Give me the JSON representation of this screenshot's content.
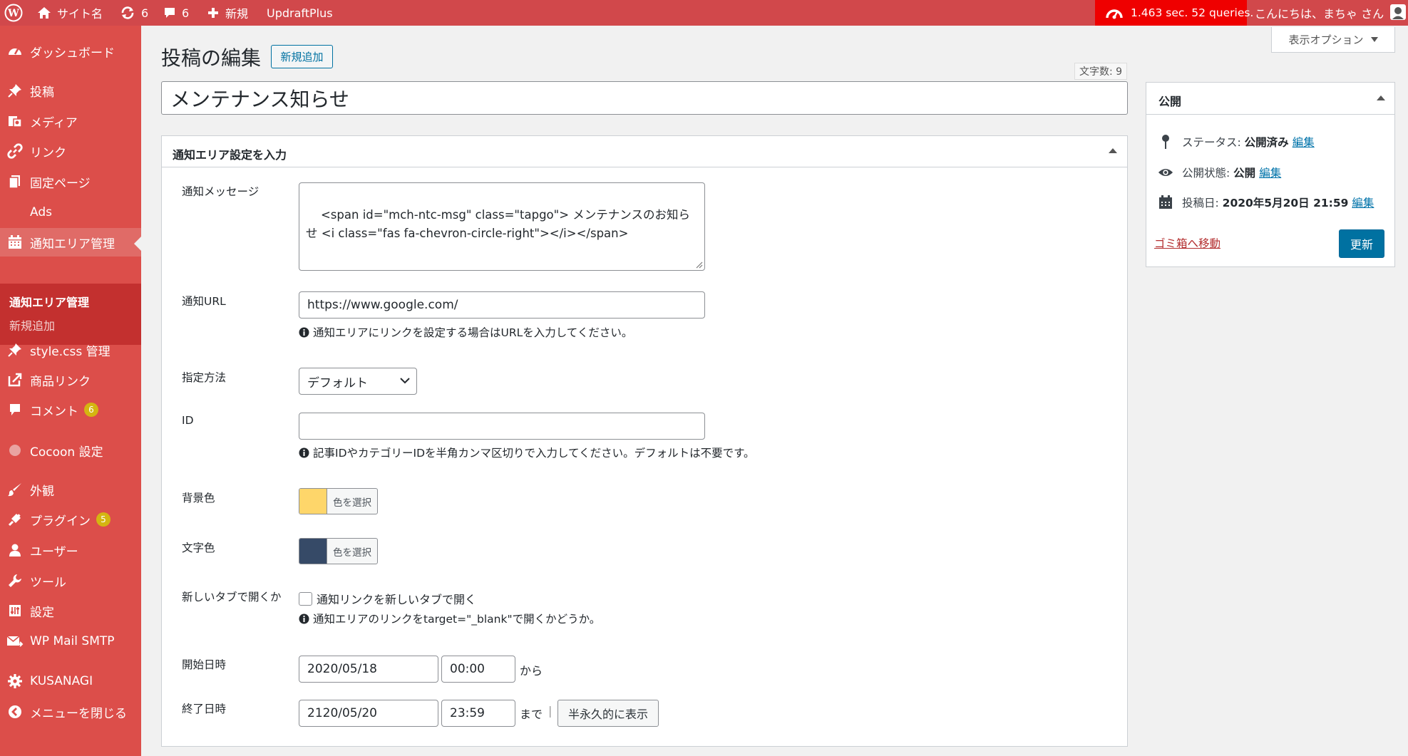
{
  "adminbar": {
    "site_name": "サイト名",
    "updates_count": "6",
    "comments_count": "6",
    "new_label": "新規",
    "plugin_label": "UpdraftPlus",
    "perf_text": "1.463 sec. 52 queries.",
    "greeting": "こんにちは、まちゃ さん"
  },
  "sidebar": {
    "items": [
      {
        "label": "ダッシュボード",
        "icon": "dashboard-icon"
      },
      {
        "label": "投稿",
        "icon": "pin-icon"
      },
      {
        "label": "メディア",
        "icon": "media-icon"
      },
      {
        "label": "リンク",
        "icon": "link-icon"
      },
      {
        "label": "固定ページ",
        "icon": "page-icon"
      },
      {
        "label": "Ads",
        "icon": ""
      },
      {
        "label": "通知エリア管理",
        "icon": "calendar-icon"
      },
      {
        "label": "style.css 管理",
        "icon": "pin-icon"
      },
      {
        "label": "商品リンク",
        "icon": "external-link-icon"
      },
      {
        "label": "コメント",
        "icon": "comment-icon",
        "badge": "6"
      },
      {
        "label": "Cocoon 設定",
        "icon": "circle-icon"
      },
      {
        "label": "外観",
        "icon": "brush-icon"
      },
      {
        "label": "プラグイン",
        "icon": "plugin-icon",
        "badge": "5"
      },
      {
        "label": "ユーザー",
        "icon": "user-icon"
      },
      {
        "label": "ツール",
        "icon": "wrench-icon"
      },
      {
        "label": "設定",
        "icon": "settings-icon"
      },
      {
        "label": "WP Mail SMTP",
        "icon": "mail-icon"
      },
      {
        "label": "KUSANAGI",
        "icon": "gear-icon"
      },
      {
        "label": "メニューを閉じる",
        "icon": "collapse-icon"
      }
    ],
    "submenu": [
      "通知エリア管理",
      "新規追加"
    ]
  },
  "header": {
    "title": "投稿の編集",
    "add_new": "新規追加",
    "screen_options": "表示オプション",
    "word_count": "文字数: 9"
  },
  "post": {
    "title": "メンテナンス知らせ"
  },
  "metabox": {
    "title": "通知エリア設定を入力",
    "message_label": "通知メッセージ",
    "message_value": "<span id=\"mch-ntc-msg\" class=\"tapgo\"> メンテナンスのお知らせ <i class=\"fas fa-chevron-circle-right\"></i></span>",
    "url_label": "通知URL",
    "url_value": "https://www.google.com/",
    "url_help": "通知エリアにリンクを設定する場合はURLを入力してください。",
    "method_label": "指定方法",
    "method_value": "デフォルト",
    "id_label": "ID",
    "id_value": "",
    "id_help": "記事IDやカテゴリーIDを半角カンマ区切りで入力してください。デフォルトは不要です。",
    "bg_label": "背景色",
    "bg_color": "#fed66a",
    "text_color_label": "文字色",
    "text_color": "#364a67",
    "choose_color": "色を選択",
    "newtab_label": "新しいタブで開くか",
    "newtab_checkbox": "通知リンクを新しいタブで開く",
    "newtab_help": "通知エリアのリンクをtarget=\"_blank\"で開くかどうか。",
    "start_label": "開始日時",
    "start_date": "2020/05/18",
    "start_time": "00:00",
    "start_suffix": "から",
    "end_label": "終了日時",
    "end_date": "2120/05/20",
    "end_time": "23:59",
    "end_suffix": "まで",
    "separator": "|",
    "permanent_btn": "半永久的に表示"
  },
  "publish": {
    "title": "公開",
    "status_label": "ステータス:",
    "status_value": "公開済み",
    "visibility_label": "公開状態:",
    "visibility_value": "公開",
    "date_label": "投稿日:",
    "date_value": "2020年5月20日 21:59",
    "edit": "編集",
    "trash": "ゴミ箱へ移動",
    "update": "更新"
  },
  "colors": {
    "adminbar": "#d1484b",
    "sidebar": "#dc4e4a",
    "submenu": "#c3302f",
    "perf": "#ef0000",
    "primary_button": "#0071a1"
  }
}
